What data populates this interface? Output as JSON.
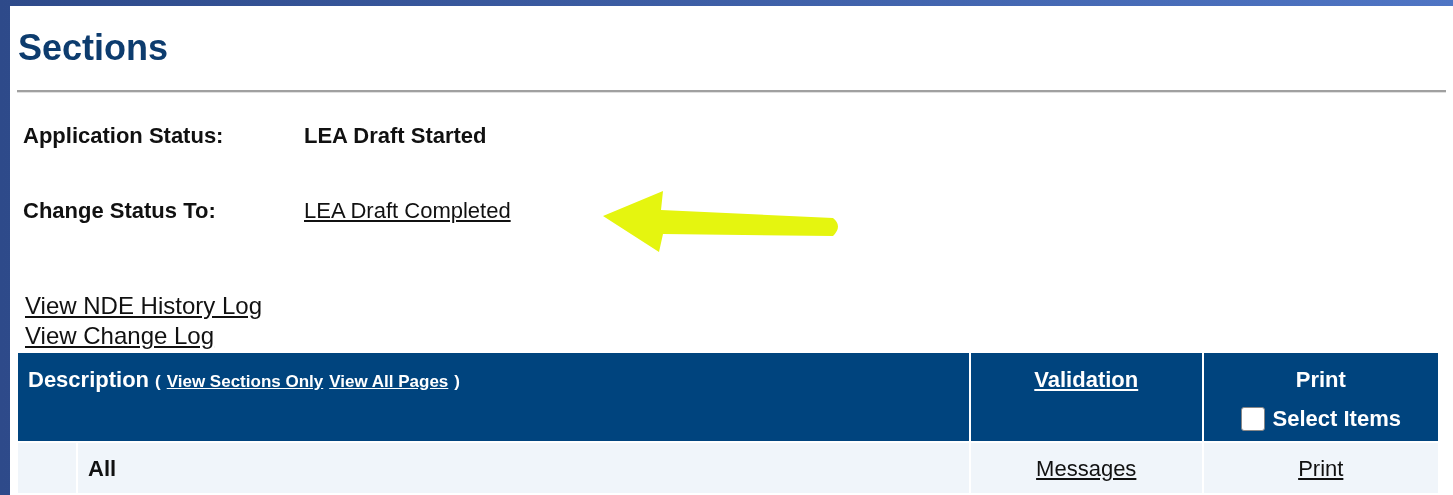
{
  "title": "Sections",
  "status": [
    {
      "label": "Application Status:",
      "value": "LEA Draft Started",
      "kind": "text"
    },
    {
      "label": "Change Status To:",
      "value": "LEA Draft Completed",
      "kind": "link"
    }
  ],
  "links": [
    "View NDE History Log",
    "View Change Log"
  ],
  "table": {
    "columns": [
      {
        "label": "Description",
        "open_paren": "(",
        "links": [
          "View Sections Only",
          "View All Pages"
        ],
        "close_paren": ")"
      },
      {
        "label": "Validation"
      },
      {
        "label": "Print",
        "checkbox": {
          "label": "Select Items",
          "checked": false
        }
      }
    ],
    "rows": [
      {
        "description": "All",
        "validation": "Messages",
        "print": "Print"
      }
    ]
  }
}
